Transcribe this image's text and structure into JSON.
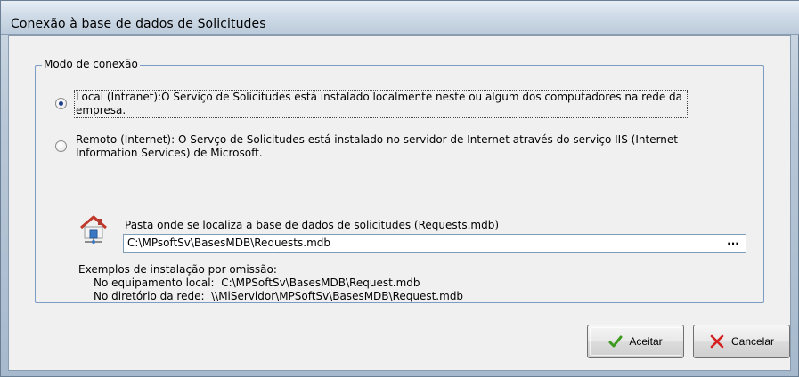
{
  "window": {
    "title": "Conexão à base de dados de Solicitudes"
  },
  "connection_mode": {
    "legend": "Modo de conexão",
    "options": [
      {
        "label_line1": "Local (Intranet):O Serviço de Solicitudes está instalado localmente neste ou algum dos computadores na rede da",
        "label_line2": "empresa.",
        "selected": true
      },
      {
        "label_line1": "Remoto (Internet): O Servço de Solicitudes está instalado no servidor de Internet através do serviço IIS (Internet",
        "label_line2": "Information Services) de Microsoft.",
        "selected": false
      }
    ]
  },
  "database_path": {
    "label": "Pasta onde se localiza a base de dados de solicitudes (Requests.mdb)",
    "value": "C:\\MPsoftSv\\BasesMDB\\Requests.mdb",
    "browse_label": "..."
  },
  "examples": {
    "heading": "Exemplos de instalação por omissão:",
    "local": "No equipamento local:  C:\\MPSoftSv\\BasesMDB\\Request.mdb",
    "network": "No diretório da rede:  \\\\MiServidor\\MPSoftSv\\BasesMDB\\Request.mdb"
  },
  "buttons": {
    "ok_label": "Aceitar",
    "cancel_label": "Cancelar"
  },
  "icons": {
    "ok": "checkmark-icon",
    "cancel": "x-close-icon",
    "database": "network-house-icon"
  },
  "colors": {
    "groupbox_border": "#7a9cc6",
    "ok_check": "#3c9a1e",
    "cancel_x": "#d42020"
  }
}
